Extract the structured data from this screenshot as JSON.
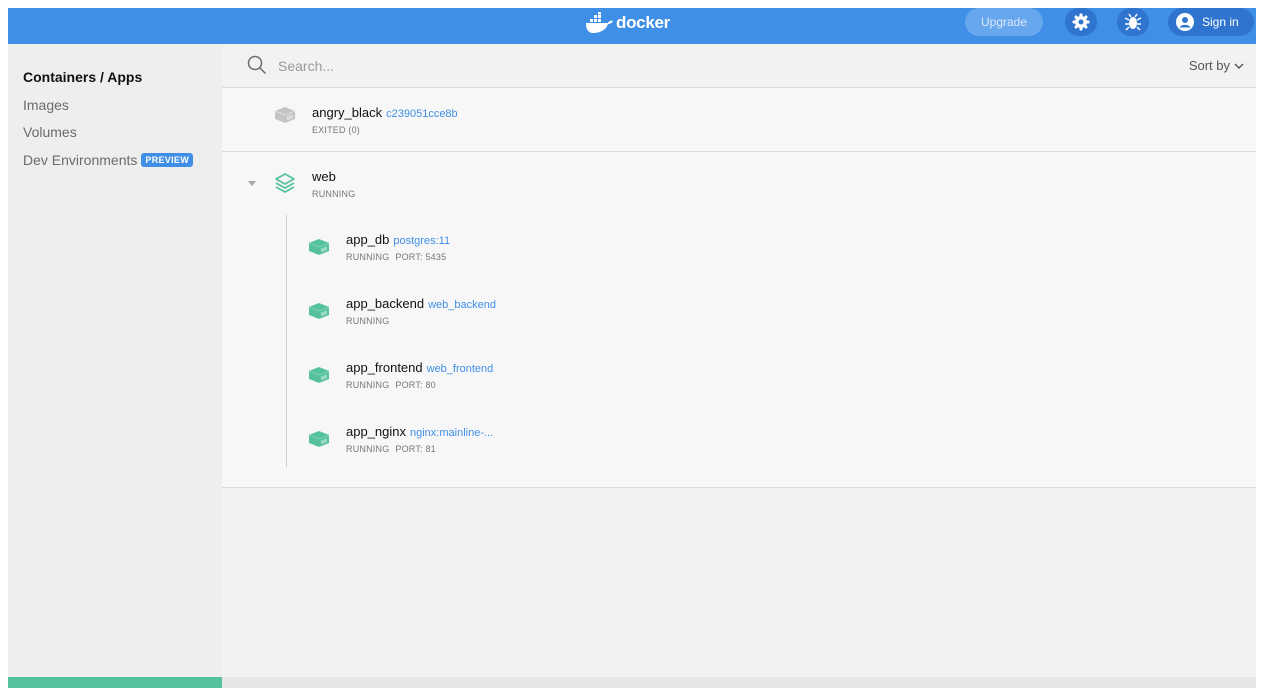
{
  "topbar": {
    "logo_text": "docker",
    "upgrade_label": "Upgrade",
    "settings_icon": "gear-icon",
    "bug_icon": "bug-icon",
    "signin_label": "Sign in",
    "brand_color": "#3f8fe6"
  },
  "sidebar": {
    "items": [
      {
        "label": "Containers / Apps",
        "active": true
      },
      {
        "label": "Images"
      },
      {
        "label": "Volumes"
      },
      {
        "label": "Dev Environments",
        "badge": "PREVIEW"
      }
    ]
  },
  "search": {
    "placeholder": "Search...",
    "sort_label": "Sort by"
  },
  "containers": [
    {
      "name": "angry_black",
      "image": "c239051cce8b",
      "status": "EXITED (0)",
      "port": ""
    },
    {
      "name": "web",
      "image": "",
      "status": "RUNNING",
      "port": "",
      "is_app": true,
      "children": [
        {
          "name": "app_db",
          "image": "postgres:11",
          "status": "RUNNING",
          "port": "PORT: 5435"
        },
        {
          "name": "app_backend",
          "image": "web_backend",
          "status": "RUNNING",
          "port": ""
        },
        {
          "name": "app_frontend",
          "image": "web_frontend",
          "status": "RUNNING",
          "port": "PORT: 80"
        },
        {
          "name": "app_nginx",
          "image": "nginx:mainline-...",
          "status": "RUNNING",
          "port": "PORT: 81"
        }
      ]
    }
  ],
  "colors": {
    "running": "#56c29b",
    "exited": "#c4c4c4",
    "link": "#3f8fe6"
  }
}
